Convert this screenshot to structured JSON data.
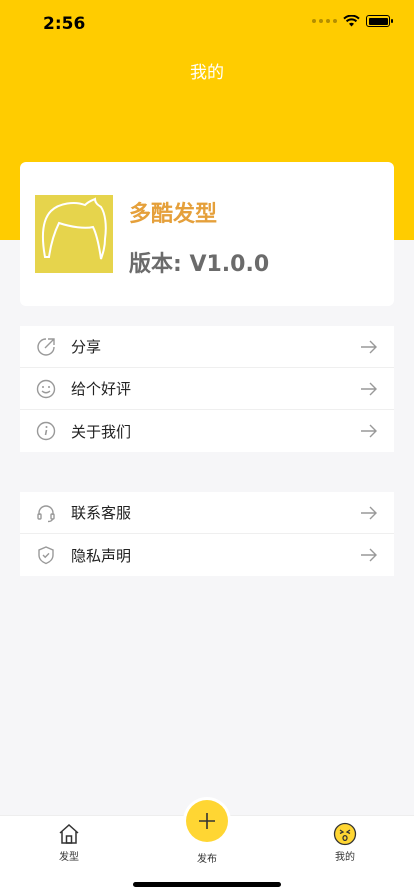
{
  "status": {
    "time": "2:56"
  },
  "header": {
    "title": "我的"
  },
  "profile": {
    "app_name": "多酷发型",
    "version": "版本: V1.0.0"
  },
  "menu_group_1": [
    {
      "label": "分享",
      "icon": "share-icon"
    },
    {
      "label": "给个好评",
      "icon": "smile-icon"
    },
    {
      "label": "关于我们",
      "icon": "info-icon"
    }
  ],
  "menu_group_2": [
    {
      "label": "联系客服",
      "icon": "headset-icon"
    },
    {
      "label": "隐私声明",
      "icon": "shield-icon"
    }
  ],
  "tabbar": {
    "home_label": "发型",
    "publish_label": "发布",
    "mine_label": "我的"
  },
  "colors": {
    "accent": "#ffcc00",
    "app_name": "#e5a03b",
    "avatar_bg": "#e6d44c"
  }
}
